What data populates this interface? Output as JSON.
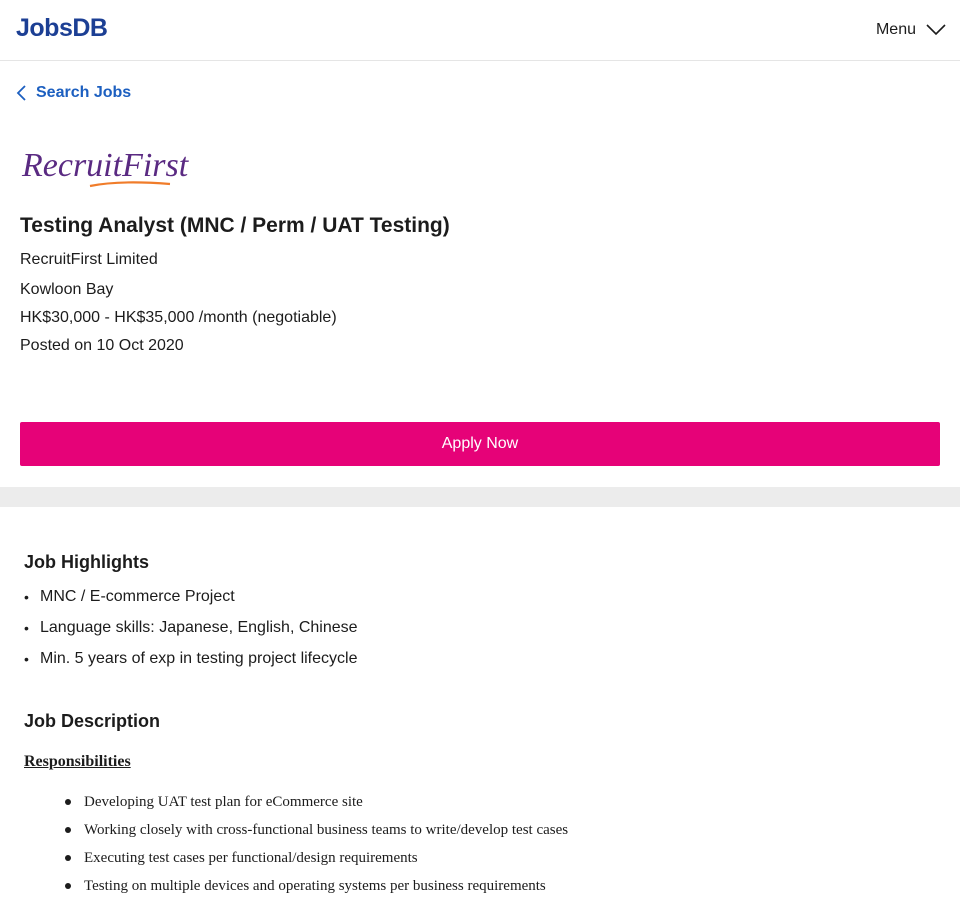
{
  "header": {
    "logo_text": "JobsDB",
    "menu_label": "Menu",
    "brand_color": "#1c3f94"
  },
  "nav": {
    "back_label": "Search Jobs"
  },
  "company_logo": {
    "text": "RecruitFirst",
    "colors": {
      "primary": "#5a2a82",
      "accent": "#f07c2a"
    }
  },
  "job": {
    "title": "Testing Analyst (MNC / Perm / UAT Testing)",
    "company": "RecruitFirst Limited",
    "location": "Kowloon Bay",
    "salary": "HK$30,000 - HK$35,000 /month (negotiable)",
    "posted": "Posted on 10 Oct 2020"
  },
  "apply": {
    "label": "Apply Now",
    "color": "#e60278"
  },
  "highlights": {
    "heading": "Job Highlights",
    "items": [
      "MNC / E-commerce Project",
      "Language skills: Japanese, English, Chinese",
      "Min. 5 years of exp in testing project lifecycle"
    ]
  },
  "description": {
    "heading": "Job Description",
    "responsibilities_heading": "Responsibilities",
    "responsibilities": [
      "Developing UAT test plan for eCommerce site",
      "Working closely with cross-functional business teams to write/develop test cases",
      "Executing test cases per functional/design requirements",
      "Testing on multiple devices and operating systems per business requirements"
    ]
  }
}
